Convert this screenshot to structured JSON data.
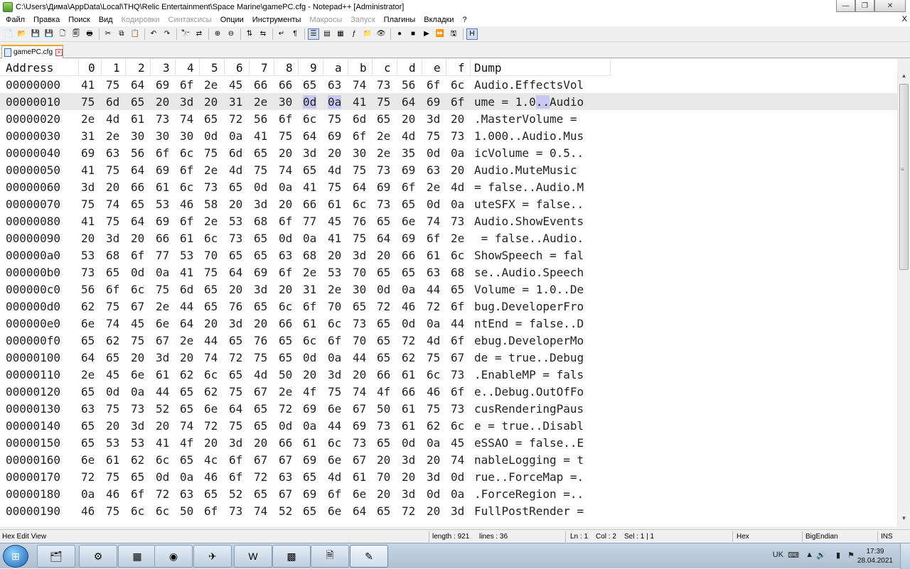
{
  "window": {
    "title": "C:\\Users\\Дима\\AppData\\Local\\THQ\\Relic Entertainment\\Space Marine\\gamePC.cfg - Notepad++ [Administrator]",
    "minimize_glyph": "—",
    "maximize_glyph": "❐",
    "close_glyph": "✕"
  },
  "menu": {
    "items": [
      {
        "label": "Файл",
        "disabled": false
      },
      {
        "label": "Правка",
        "disabled": false
      },
      {
        "label": "Поиск",
        "disabled": false
      },
      {
        "label": "Вид",
        "disabled": false
      },
      {
        "label": "Кодировки",
        "disabled": true
      },
      {
        "label": "Синтаксисы",
        "disabled": true
      },
      {
        "label": "Опции",
        "disabled": false
      },
      {
        "label": "Инструменты",
        "disabled": false
      },
      {
        "label": "Макросы",
        "disabled": true
      },
      {
        "label": "Запуск",
        "disabled": true
      },
      {
        "label": "Плагины",
        "disabled": false
      },
      {
        "label": "Вкладки",
        "disabled": false
      },
      {
        "label": "?",
        "disabled": false
      }
    ],
    "close_glyph": "X"
  },
  "toolbar": {
    "buttons": [
      {
        "icon": "new-file-icon",
        "glyph": "📄"
      },
      {
        "icon": "open-file-icon",
        "glyph": "📂"
      },
      {
        "icon": "save-icon",
        "glyph": "💾"
      },
      {
        "icon": "save-all-icon",
        "glyph": "💾"
      },
      {
        "icon": "close-file-icon",
        "glyph": "🗋"
      },
      {
        "icon": "close-all-icon",
        "glyph": "🗐"
      },
      {
        "icon": "print-icon",
        "glyph": "🖶"
      },
      {
        "sep": true
      },
      {
        "icon": "cut-icon",
        "glyph": "✂"
      },
      {
        "icon": "copy-icon",
        "glyph": "⧉"
      },
      {
        "icon": "paste-icon",
        "glyph": "📋"
      },
      {
        "sep": true
      },
      {
        "icon": "undo-icon",
        "glyph": "↶"
      },
      {
        "icon": "redo-icon",
        "glyph": "↷"
      },
      {
        "sep": true
      },
      {
        "icon": "find-icon",
        "glyph": "🔭"
      },
      {
        "icon": "replace-icon",
        "glyph": "⇄"
      },
      {
        "sep": true
      },
      {
        "icon": "zoom-in-icon",
        "glyph": "⊕"
      },
      {
        "icon": "zoom-out-icon",
        "glyph": "⊖"
      },
      {
        "sep": true
      },
      {
        "icon": "sync-vertical-icon",
        "glyph": "⇅"
      },
      {
        "icon": "sync-horizontal-icon",
        "glyph": "⇆"
      },
      {
        "sep": true
      },
      {
        "icon": "word-wrap-icon",
        "glyph": "↵"
      },
      {
        "icon": "show-all-chars-icon",
        "glyph": "¶"
      },
      {
        "sep": true
      },
      {
        "icon": "indent-guide-icon",
        "glyph": "☰",
        "active": true
      },
      {
        "icon": "udl-icon",
        "glyph": "▤"
      },
      {
        "icon": "doc-map-icon",
        "glyph": "▦"
      },
      {
        "icon": "function-list-icon",
        "glyph": "ƒ"
      },
      {
        "icon": "folder-workspace-icon",
        "glyph": "📁"
      },
      {
        "icon": "monitoring-icon",
        "glyph": "👁"
      },
      {
        "sep": true
      },
      {
        "icon": "record-macro-icon",
        "glyph": "●"
      },
      {
        "icon": "stop-macro-icon",
        "glyph": "■"
      },
      {
        "icon": "play-macro-icon",
        "glyph": "▶"
      },
      {
        "icon": "run-macro-multiple-icon",
        "glyph": "⏩"
      },
      {
        "icon": "save-macro-icon",
        "glyph": "🖫"
      },
      {
        "sep": true
      },
      {
        "icon": "hex-editor-icon",
        "glyph": "H",
        "active": true
      }
    ]
  },
  "tab": {
    "label": "gamePC.cfg",
    "close_glyph": "✕"
  },
  "hex": {
    "header": {
      "address": "Address",
      "columns": [
        "0",
        "1",
        "2",
        "3",
        "4",
        "5",
        "6",
        "7",
        "8",
        "9",
        "a",
        "b",
        "c",
        "d",
        "e",
        "f"
      ],
      "dump": "Dump"
    },
    "rows": [
      {
        "addr": "00000000",
        "bytes": [
          "41",
          "75",
          "64",
          "69",
          "6f",
          "2e",
          "45",
          "66",
          "66",
          "65",
          "63",
          "74",
          "73",
          "56",
          "6f",
          "6c"
        ],
        "dump": "Audio.EffectsVol"
      },
      {
        "addr": "00000010",
        "bytes": [
          "75",
          "6d",
          "65",
          "20",
          "3d",
          "20",
          "31",
          "2e",
          "30",
          "0d",
          "0a",
          "41",
          "75",
          "64",
          "69",
          "6f"
        ],
        "dump": "ume = 1.0..Audio"
      },
      {
        "addr": "00000020",
        "bytes": [
          "2e",
          "4d",
          "61",
          "73",
          "74",
          "65",
          "72",
          "56",
          "6f",
          "6c",
          "75",
          "6d",
          "65",
          "20",
          "3d",
          "20"
        ],
        "dump": ".MasterVolume = "
      },
      {
        "addr": "00000030",
        "bytes": [
          "31",
          "2e",
          "30",
          "30",
          "30",
          "0d",
          "0a",
          "41",
          "75",
          "64",
          "69",
          "6f",
          "2e",
          "4d",
          "75",
          "73"
        ],
        "dump": "1.000..Audio.Mus"
      },
      {
        "addr": "00000040",
        "bytes": [
          "69",
          "63",
          "56",
          "6f",
          "6c",
          "75",
          "6d",
          "65",
          "20",
          "3d",
          "20",
          "30",
          "2e",
          "35",
          "0d",
          "0a"
        ],
        "dump": "icVolume = 0.5.."
      },
      {
        "addr": "00000050",
        "bytes": [
          "41",
          "75",
          "64",
          "69",
          "6f",
          "2e",
          "4d",
          "75",
          "74",
          "65",
          "4d",
          "75",
          "73",
          "69",
          "63",
          "20"
        ],
        "dump": "Audio.MuteMusic "
      },
      {
        "addr": "00000060",
        "bytes": [
          "3d",
          "20",
          "66",
          "61",
          "6c",
          "73",
          "65",
          "0d",
          "0a",
          "41",
          "75",
          "64",
          "69",
          "6f",
          "2e",
          "4d"
        ],
        "dump": "= false..Audio.M"
      },
      {
        "addr": "00000070",
        "bytes": [
          "75",
          "74",
          "65",
          "53",
          "46",
          "58",
          "20",
          "3d",
          "20",
          "66",
          "61",
          "6c",
          "73",
          "65",
          "0d",
          "0a"
        ],
        "dump": "uteSFX = false.."
      },
      {
        "addr": "00000080",
        "bytes": [
          "41",
          "75",
          "64",
          "69",
          "6f",
          "2e",
          "53",
          "68",
          "6f",
          "77",
          "45",
          "76",
          "65",
          "6e",
          "74",
          "73"
        ],
        "dump": "Audio.ShowEvents"
      },
      {
        "addr": "00000090",
        "bytes": [
          "20",
          "3d",
          "20",
          "66",
          "61",
          "6c",
          "73",
          "65",
          "0d",
          "0a",
          "41",
          "75",
          "64",
          "69",
          "6f",
          "2e"
        ],
        "dump": " = false..Audio."
      },
      {
        "addr": "000000a0",
        "bytes": [
          "53",
          "68",
          "6f",
          "77",
          "53",
          "70",
          "65",
          "65",
          "63",
          "68",
          "20",
          "3d",
          "20",
          "66",
          "61",
          "6c"
        ],
        "dump": "ShowSpeech = fal"
      },
      {
        "addr": "000000b0",
        "bytes": [
          "73",
          "65",
          "0d",
          "0a",
          "41",
          "75",
          "64",
          "69",
          "6f",
          "2e",
          "53",
          "70",
          "65",
          "65",
          "63",
          "68"
        ],
        "dump": "se..Audio.Speech"
      },
      {
        "addr": "000000c0",
        "bytes": [
          "56",
          "6f",
          "6c",
          "75",
          "6d",
          "65",
          "20",
          "3d",
          "20",
          "31",
          "2e",
          "30",
          "0d",
          "0a",
          "44",
          "65"
        ],
        "dump": "Volume = 1.0..De"
      },
      {
        "addr": "000000d0",
        "bytes": [
          "62",
          "75",
          "67",
          "2e",
          "44",
          "65",
          "76",
          "65",
          "6c",
          "6f",
          "70",
          "65",
          "72",
          "46",
          "72",
          "6f"
        ],
        "dump": "bug.DeveloperFro"
      },
      {
        "addr": "000000e0",
        "bytes": [
          "6e",
          "74",
          "45",
          "6e",
          "64",
          "20",
          "3d",
          "20",
          "66",
          "61",
          "6c",
          "73",
          "65",
          "0d",
          "0a",
          "44"
        ],
        "dump": "ntEnd = false..D"
      },
      {
        "addr": "000000f0",
        "bytes": [
          "65",
          "62",
          "75",
          "67",
          "2e",
          "44",
          "65",
          "76",
          "65",
          "6c",
          "6f",
          "70",
          "65",
          "72",
          "4d",
          "6f"
        ],
        "dump": "ebug.DeveloperMo"
      },
      {
        "addr": "00000100",
        "bytes": [
          "64",
          "65",
          "20",
          "3d",
          "20",
          "74",
          "72",
          "75",
          "65",
          "0d",
          "0a",
          "44",
          "65",
          "62",
          "75",
          "67"
        ],
        "dump": "de = true..Debug"
      },
      {
        "addr": "00000110",
        "bytes": [
          "2e",
          "45",
          "6e",
          "61",
          "62",
          "6c",
          "65",
          "4d",
          "50",
          "20",
          "3d",
          "20",
          "66",
          "61",
          "6c",
          "73"
        ],
        "dump": ".EnableMP = fals"
      },
      {
        "addr": "00000120",
        "bytes": [
          "65",
          "0d",
          "0a",
          "44",
          "65",
          "62",
          "75",
          "67",
          "2e",
          "4f",
          "75",
          "74",
          "4f",
          "66",
          "46",
          "6f"
        ],
        "dump": "e..Debug.OutOfFo"
      },
      {
        "addr": "00000130",
        "bytes": [
          "63",
          "75",
          "73",
          "52",
          "65",
          "6e",
          "64",
          "65",
          "72",
          "69",
          "6e",
          "67",
          "50",
          "61",
          "75",
          "73"
        ],
        "dump": "cusRenderingPaus"
      },
      {
        "addr": "00000140",
        "bytes": [
          "65",
          "20",
          "3d",
          "20",
          "74",
          "72",
          "75",
          "65",
          "0d",
          "0a",
          "44",
          "69",
          "73",
          "61",
          "62",
          "6c"
        ],
        "dump": "e = true..Disabl"
      },
      {
        "addr": "00000150",
        "bytes": [
          "65",
          "53",
          "53",
          "41",
          "4f",
          "20",
          "3d",
          "20",
          "66",
          "61",
          "6c",
          "73",
          "65",
          "0d",
          "0a",
          "45"
        ],
        "dump": "eSSAO = false..E"
      },
      {
        "addr": "00000160",
        "bytes": [
          "6e",
          "61",
          "62",
          "6c",
          "65",
          "4c",
          "6f",
          "67",
          "67",
          "69",
          "6e",
          "67",
          "20",
          "3d",
          "20",
          "74"
        ],
        "dump": "nableLogging = t"
      },
      {
        "addr": "00000170",
        "bytes": [
          "72",
          "75",
          "65",
          "0d",
          "0a",
          "46",
          "6f",
          "72",
          "63",
          "65",
          "4d",
          "61",
          "70",
          "20",
          "3d",
          "0d"
        ],
        "dump": "rue..ForceMap =."
      },
      {
        "addr": "00000180",
        "bytes": [
          "0a",
          "46",
          "6f",
          "72",
          "63",
          "65",
          "52",
          "65",
          "67",
          "69",
          "6f",
          "6e",
          "20",
          "3d",
          "0d",
          "0a"
        ],
        "dump": ".ForceRegion =.."
      },
      {
        "addr": "00000190",
        "bytes": [
          "46",
          "75",
          "6c",
          "6c",
          "50",
          "6f",
          "73",
          "74",
          "52",
          "65",
          "6e",
          "64",
          "65",
          "72",
          "20",
          "3d"
        ],
        "dump": "FullPostRender ="
      }
    ],
    "selected_row": 1,
    "selected_byte_cols": [
      9,
      10
    ],
    "selected_dump_chars": [
      9,
      10
    ]
  },
  "status": {
    "mode": "Hex Edit View",
    "length": "length : 921",
    "lines": "lines : 36",
    "ln": "Ln : 1",
    "col": "Col : 2",
    "sel": "Sel : 1 | 1",
    "format": "Hex",
    "endian": "BigEndian",
    "ins": "INS"
  },
  "taskbar": {
    "apps": [
      {
        "name": "taskbar-file-explorer",
        "glyph": "🗂"
      },
      {
        "name": "taskbar-control-panel",
        "glyph": "⚙"
      },
      {
        "name": "taskbar-resource-monitor",
        "glyph": "▦"
      },
      {
        "name": "taskbar-chrome",
        "glyph": "◉"
      },
      {
        "name": "taskbar-telegram",
        "glyph": "✈"
      },
      {
        "name": "taskbar-word",
        "glyph": "W"
      },
      {
        "name": "taskbar-winrar",
        "glyph": "▩"
      },
      {
        "name": "taskbar-document",
        "glyph": "🗎"
      },
      {
        "name": "taskbar-notepadpp",
        "glyph": "✎",
        "active": true
      }
    ],
    "tray": {
      "lang": "UK",
      "clock_time": "17:39",
      "clock_date": "28.04.2021"
    }
  }
}
